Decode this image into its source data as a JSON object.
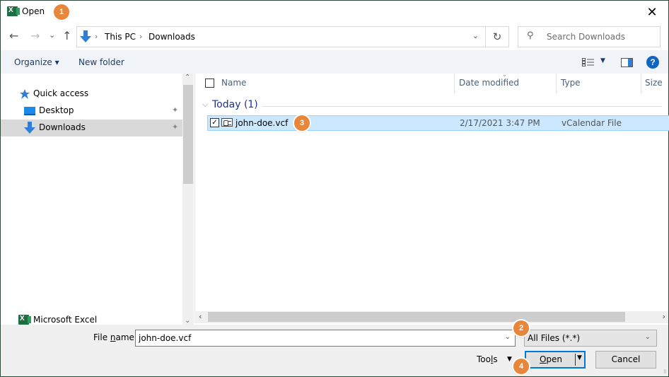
{
  "window": {
    "title": "Open",
    "app_icon": "excel-icon",
    "close_glyph": "✕"
  },
  "badges": {
    "b1": "1",
    "b2": "2",
    "b3": "3",
    "b4": "4",
    "color": "#e8863a"
  },
  "nav": {
    "back_glyph": "←",
    "forward_glyph": "→",
    "recent_glyph": "⌄",
    "up_glyph": "↑",
    "breadcrumb": [
      "This PC",
      "Downloads"
    ],
    "breadcrumb_sep": "›",
    "dropdown_glyph": "⌄",
    "refresh_glyph": "↻",
    "search_placeholder": "Search Downloads",
    "search_glyph": "⚲"
  },
  "toolbar": {
    "organize_label": "Organize ▾",
    "new_folder_label": "New folder",
    "views_dropdown_glyph": "▼",
    "help_label": "?"
  },
  "sidebar": {
    "items": [
      {
        "label": "Quick access",
        "icon": "star-icon"
      },
      {
        "label": "Desktop",
        "icon": "desktop-icon",
        "pinned": true
      },
      {
        "label": "Downloads",
        "icon": "download-icon",
        "pinned": true,
        "selected": true
      },
      {
        "label": "Microsoft Excel",
        "icon": "excel-icon"
      }
    ],
    "pin_glyph": "📌"
  },
  "file_list": {
    "columns": [
      "Name",
      "Date modified",
      "Type",
      "Size"
    ],
    "sort_indicator": "⌄",
    "groups": [
      {
        "label": "Today (1)",
        "chevron": "⌵",
        "files": [
          {
            "name": "john-doe.vcf",
            "date_modified": "2/17/2021 3:47 PM",
            "type": "vCalendar File",
            "size": "",
            "checked": true,
            "selected": true
          }
        ]
      }
    ]
  },
  "scrollbars": {
    "up": "⌃",
    "down": "⌄",
    "left": "‹",
    "right": "›"
  },
  "footer": {
    "file_name_label_pre": "File ",
    "file_name_label_u": "n",
    "file_name_label_post": "ame:",
    "file_name_value": "john-doe.vcf",
    "file_type_value": "All Files (*.*)",
    "dropdown_glyph": "⌄",
    "tools_pre": "Too",
    "tools_u": "l",
    "tools_post": "s",
    "tools_dd": "▼",
    "open_u": "O",
    "open_post": "pen",
    "open_dd": "▼",
    "cancel_label": "Cancel",
    "grip": "⠿"
  },
  "colors": {
    "selection_bg": "#cce8ff",
    "selection_border": "#99d1ff",
    "accent": "#0078d7",
    "group_header": "#1e3287"
  }
}
